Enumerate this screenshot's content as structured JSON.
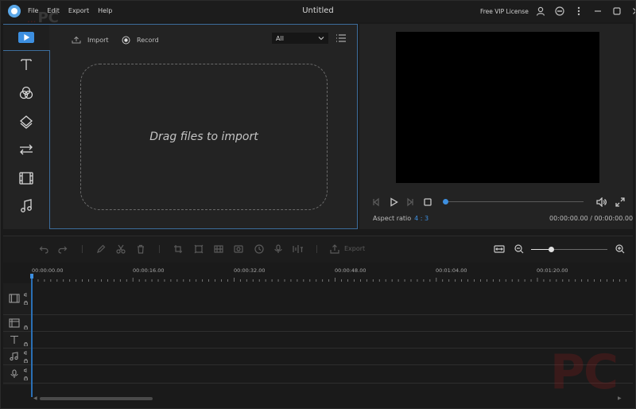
{
  "titlebar": {
    "title": "Untitled",
    "menu": [
      "File",
      "Edit",
      "Export",
      "Help"
    ],
    "license": "Free VIP License",
    "icons": [
      "user-icon",
      "feedback-icon",
      "more-icon",
      "minimize-icon",
      "maximize-icon",
      "close-icon"
    ]
  },
  "watermark": {
    "left_text": "...",
    "left_bold": "PC",
    "right_text": "PC"
  },
  "sidebar": {
    "tools": [
      "media-icon",
      "text-icon",
      "filter-icon",
      "overlay-icon",
      "transition-icon",
      "element-icon",
      "music-icon"
    ],
    "active": "media-icon",
    "accent": "#3d8fe0"
  },
  "media": {
    "import_label": "Import",
    "record_label": "Record",
    "filter_value": "All",
    "drop_text": "Drag files to import"
  },
  "preview": {
    "aspect_label": "Aspect ratio",
    "aspect_value": "4 : 3",
    "timecode": "00:00:00.00 / 00:00:00.00",
    "progress": 0
  },
  "timeline": {
    "export_label": "Export",
    "zoom_level": 0.27,
    "ruler": [
      "00:00:00.00",
      "00:00:16.00",
      "00:00:32.00",
      "00:00:48.00",
      "00:01:04.00",
      "00:01:20.00"
    ],
    "tracks": [
      "video-track-icon",
      "overlay-track-icon",
      "text-track-icon",
      "music-track-icon",
      "voice-track-icon"
    ]
  },
  "colors": {
    "accent": "#3d8fe0",
    "panel": "#232323",
    "background": "#1a1a1a"
  }
}
